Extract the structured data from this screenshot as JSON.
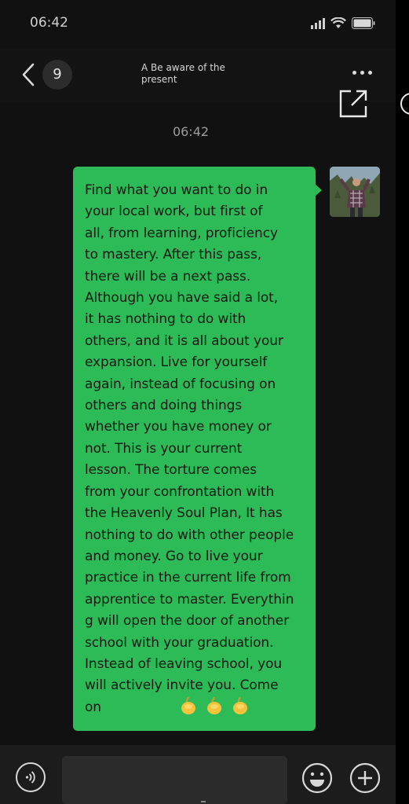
{
  "status_bar": {
    "time": "06:42"
  },
  "header": {
    "unread_count": "9",
    "chat_title": "A Be aware of the present"
  },
  "conversation": {
    "timestamp": "06:42",
    "messages": [
      {
        "sender": "self",
        "text": "Find what you want to do in\nyour local work, but first of\nall, from learning, proficiency\nto mastery. After this pass,\nthere will be a next pass.\nAlthough you have said a lot,\nit has nothing to do with\nothers, and it is all about your\nexpansion. Live for yourself\nagain, instead of focusing on\nothers and doing things\nwhether you have money or\nnot. This is your current\nlesson. The torture comes\nfrom your confrontation with\nthe Heavenly Soul Plan, It has\nnothing to do with other people\nand money. Go to live your\npractice in the current life from\napprentice to master. Everythin\ng will open the door of another\nschool with your graduation.\nInstead of leaving school, you\nwill actively invite you. Come\non",
        "emojis": [
          "fist-emoji",
          "fist-emoji",
          "fist-emoji"
        ]
      }
    ]
  },
  "input_bar": {
    "value": "",
    "placeholder": ""
  },
  "icons": {
    "back": "chevron-left-icon",
    "more": "more-dots-icon",
    "share": "external-link-icon",
    "voice": "voice-icon",
    "emoji": "smiley-icon",
    "add": "plus-icon"
  },
  "colors": {
    "background": "#111111",
    "bubble": "#2dbb57",
    "input_bar": "#1c1c1c"
  }
}
